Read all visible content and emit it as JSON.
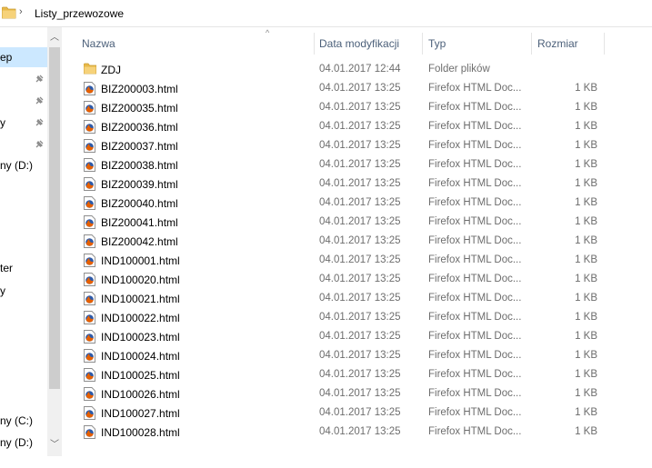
{
  "address": {
    "crumb": "Listy_przewozowe",
    "separator": "›"
  },
  "nav": {
    "items": [
      {
        "label": "ep",
        "selected": true
      },
      {
        "label": "",
        "pinned": true
      },
      {
        "label": "",
        "pinned": true
      },
      {
        "label": "y",
        "pinned": true
      },
      {
        "label": "",
        "pinned": true
      },
      {
        "label": "ny (D:)"
      },
      {
        "label": "ter"
      },
      {
        "label": "y"
      },
      {
        "label": "ny (C:)"
      },
      {
        "label": "ny (D:)"
      }
    ],
    "scroll_up": "︿",
    "scroll_down": "﹀"
  },
  "columns": {
    "name": "Nazwa",
    "date": "Data modyfikacji",
    "type": "Typ",
    "size": "Rozmiar",
    "sort_indicator": "^"
  },
  "files": [
    {
      "icon": "folder-icon",
      "name": "ZDJ",
      "date": "04.01.2017 12:44",
      "type": "Folder plików",
      "size": ""
    },
    {
      "icon": "html-file-icon",
      "name": "BIZ200003.html",
      "date": "04.01.2017 13:25",
      "type": "Firefox HTML Doc...",
      "size": "1 KB"
    },
    {
      "icon": "html-file-icon",
      "name": "BIZ200035.html",
      "date": "04.01.2017 13:25",
      "type": "Firefox HTML Doc...",
      "size": "1 KB"
    },
    {
      "icon": "html-file-icon",
      "name": "BIZ200036.html",
      "date": "04.01.2017 13:25",
      "type": "Firefox HTML Doc...",
      "size": "1 KB"
    },
    {
      "icon": "html-file-icon",
      "name": "BIZ200037.html",
      "date": "04.01.2017 13:25",
      "type": "Firefox HTML Doc...",
      "size": "1 KB"
    },
    {
      "icon": "html-file-icon",
      "name": "BIZ200038.html",
      "date": "04.01.2017 13:25",
      "type": "Firefox HTML Doc...",
      "size": "1 KB"
    },
    {
      "icon": "html-file-icon",
      "name": "BIZ200039.html",
      "date": "04.01.2017 13:25",
      "type": "Firefox HTML Doc...",
      "size": "1 KB"
    },
    {
      "icon": "html-file-icon",
      "name": "BIZ200040.html",
      "date": "04.01.2017 13:25",
      "type": "Firefox HTML Doc...",
      "size": "1 KB"
    },
    {
      "icon": "html-file-icon",
      "name": "BIZ200041.html",
      "date": "04.01.2017 13:25",
      "type": "Firefox HTML Doc...",
      "size": "1 KB"
    },
    {
      "icon": "html-file-icon",
      "name": "BIZ200042.html",
      "date": "04.01.2017 13:25",
      "type": "Firefox HTML Doc...",
      "size": "1 KB"
    },
    {
      "icon": "html-file-icon",
      "name": "IND100001.html",
      "date": "04.01.2017 13:25",
      "type": "Firefox HTML Doc...",
      "size": "1 KB"
    },
    {
      "icon": "html-file-icon",
      "name": "IND100020.html",
      "date": "04.01.2017 13:25",
      "type": "Firefox HTML Doc...",
      "size": "1 KB"
    },
    {
      "icon": "html-file-icon",
      "name": "IND100021.html",
      "date": "04.01.2017 13:25",
      "type": "Firefox HTML Doc...",
      "size": "1 KB"
    },
    {
      "icon": "html-file-icon",
      "name": "IND100022.html",
      "date": "04.01.2017 13:25",
      "type": "Firefox HTML Doc...",
      "size": "1 KB"
    },
    {
      "icon": "html-file-icon",
      "name": "IND100023.html",
      "date": "04.01.2017 13:25",
      "type": "Firefox HTML Doc...",
      "size": "1 KB"
    },
    {
      "icon": "html-file-icon",
      "name": "IND100024.html",
      "date": "04.01.2017 13:25",
      "type": "Firefox HTML Doc...",
      "size": "1 KB"
    },
    {
      "icon": "html-file-icon",
      "name": "IND100025.html",
      "date": "04.01.2017 13:25",
      "type": "Firefox HTML Doc...",
      "size": "1 KB"
    },
    {
      "icon": "html-file-icon",
      "name": "IND100026.html",
      "date": "04.01.2017 13:25",
      "type": "Firefox HTML Doc...",
      "size": "1 KB"
    },
    {
      "icon": "html-file-icon",
      "name": "IND100027.html",
      "date": "04.01.2017 13:25",
      "type": "Firefox HTML Doc...",
      "size": "1 KB"
    },
    {
      "icon": "html-file-icon",
      "name": "IND100028.html",
      "date": "04.01.2017 13:25",
      "type": "Firefox HTML Doc...",
      "size": "1 KB"
    }
  ],
  "colors": {
    "selection": "#cce8ff",
    "header_text": "#4c607a",
    "folder": "#e8b94a",
    "firefox_orange": "#e66000",
    "firefox_blue": "#2e5aa8"
  }
}
